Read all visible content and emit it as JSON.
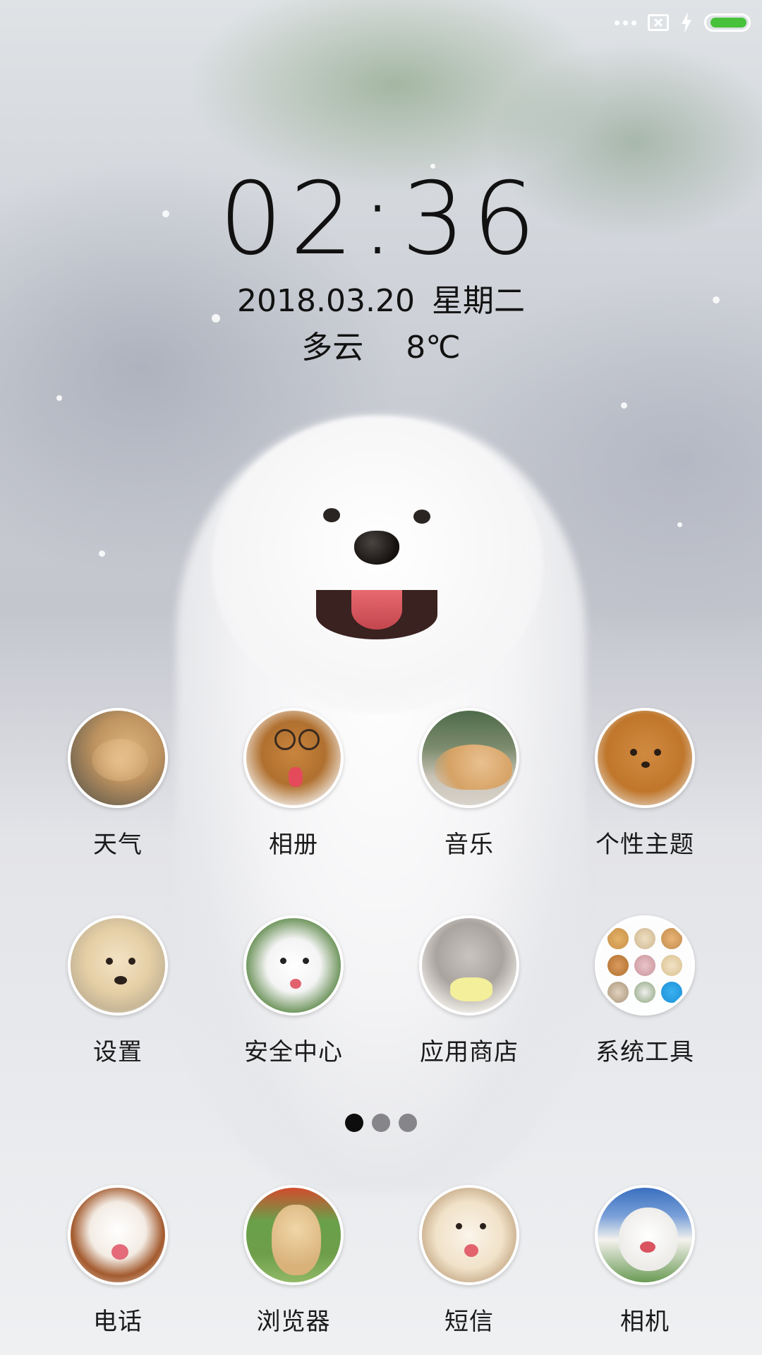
{
  "status_bar": {
    "icons": [
      "more-dots-icon",
      "no-sim-icon",
      "charging-bolt-icon",
      "battery-icon"
    ],
    "battery_level": 0.95,
    "battery_color": "#47c23a"
  },
  "lockscreen": {
    "time": "02:36",
    "date": "2018.03.20",
    "weekday": "星期二",
    "weather": "多云",
    "temperature": "8℃"
  },
  "apps": {
    "row1": [
      {
        "label": "天气",
        "icon": "weather-app-icon"
      },
      {
        "label": "相册",
        "icon": "gallery-app-icon"
      },
      {
        "label": "音乐",
        "icon": "music-app-icon"
      },
      {
        "label": "个性主题",
        "icon": "themes-app-icon"
      }
    ],
    "row2": [
      {
        "label": "设置",
        "icon": "settings-app-icon"
      },
      {
        "label": "安全中心",
        "icon": "security-app-icon"
      },
      {
        "label": "应用商店",
        "icon": "app-store-icon"
      },
      {
        "label": "系统工具",
        "icon": "system-tools-folder-icon"
      }
    ]
  },
  "page_indicator": {
    "pages": 3,
    "current": 1
  },
  "dock": [
    {
      "label": "电话",
      "icon": "phone-app-icon"
    },
    {
      "label": "浏览器",
      "icon": "browser-app-icon"
    },
    {
      "label": "短信",
      "icon": "messages-app-icon"
    },
    {
      "label": "相机",
      "icon": "camera-app-icon"
    }
  ]
}
